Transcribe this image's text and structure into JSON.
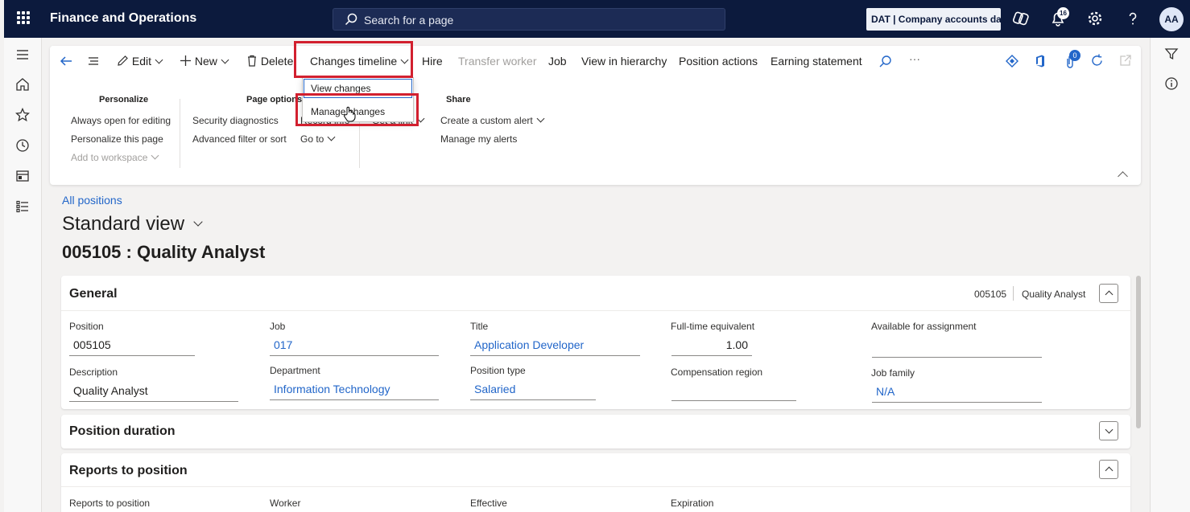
{
  "topbar": {
    "app_title": "Finance and Operations",
    "search_placeholder": "Search for a page",
    "company": "DAT | Company accounts data",
    "notification_count": "16",
    "avatar_initials": "AA"
  },
  "action_pane": {
    "edit": "Edit",
    "new": "New",
    "delete": "Delete",
    "changes_timeline": "Changes timeline",
    "hire": "Hire",
    "transfer_worker": "Transfer worker",
    "job": "Job",
    "view_in_hierarchy": "View in hierarchy",
    "position_actions": "Position actions",
    "earning_statement": "Earning statement",
    "more": "···",
    "attachments_count": "0"
  },
  "dropdown": {
    "view_changes": "View changes",
    "manage_changes": "Manage changes"
  },
  "groups": {
    "personalize": {
      "title": "Personalize",
      "items": [
        "Always open for editing",
        "Personalize this page",
        "Add to workspace"
      ]
    },
    "page_options": {
      "title": "Page options",
      "items": [
        "Security diagnostics",
        "Advanced filter or sort",
        "Record info",
        "Go to",
        "Get a link"
      ]
    },
    "share": {
      "title": "Share",
      "items": [
        "Create a custom alert",
        "Manage my alerts"
      ]
    }
  },
  "content": {
    "breadcrumb": "All positions",
    "view_title": "Standard view",
    "record_title": "005105 : Quality Analyst"
  },
  "general": {
    "title": "General",
    "summary_id": "005105",
    "summary_name": "Quality Analyst",
    "fields": {
      "position_label": "Position",
      "position_value": "005105",
      "job_label": "Job",
      "job_value": "017",
      "title_label": "Title",
      "title_value": "Application Developer",
      "fte_label": "Full-time equivalent",
      "fte_value": "1.00",
      "available_label": "Available for assignment",
      "available_value": "",
      "description_label": "Description",
      "description_value": "Quality Analyst",
      "department_label": "Department",
      "department_value": "Information Technology",
      "position_type_label": "Position type",
      "position_type_value": "Salaried",
      "comp_region_label": "Compensation region",
      "comp_region_value": "",
      "job_family_label": "Job family",
      "job_family_value": "N/A"
    }
  },
  "position_duration": {
    "title": "Position duration"
  },
  "reports_to": {
    "title": "Reports to position",
    "columns": [
      "Reports to position",
      "Worker",
      "Effective",
      "Expiration"
    ]
  },
  "colors": {
    "topbar": "#0c1a3d",
    "link": "#2266c9",
    "highlight": "#d2202f"
  }
}
